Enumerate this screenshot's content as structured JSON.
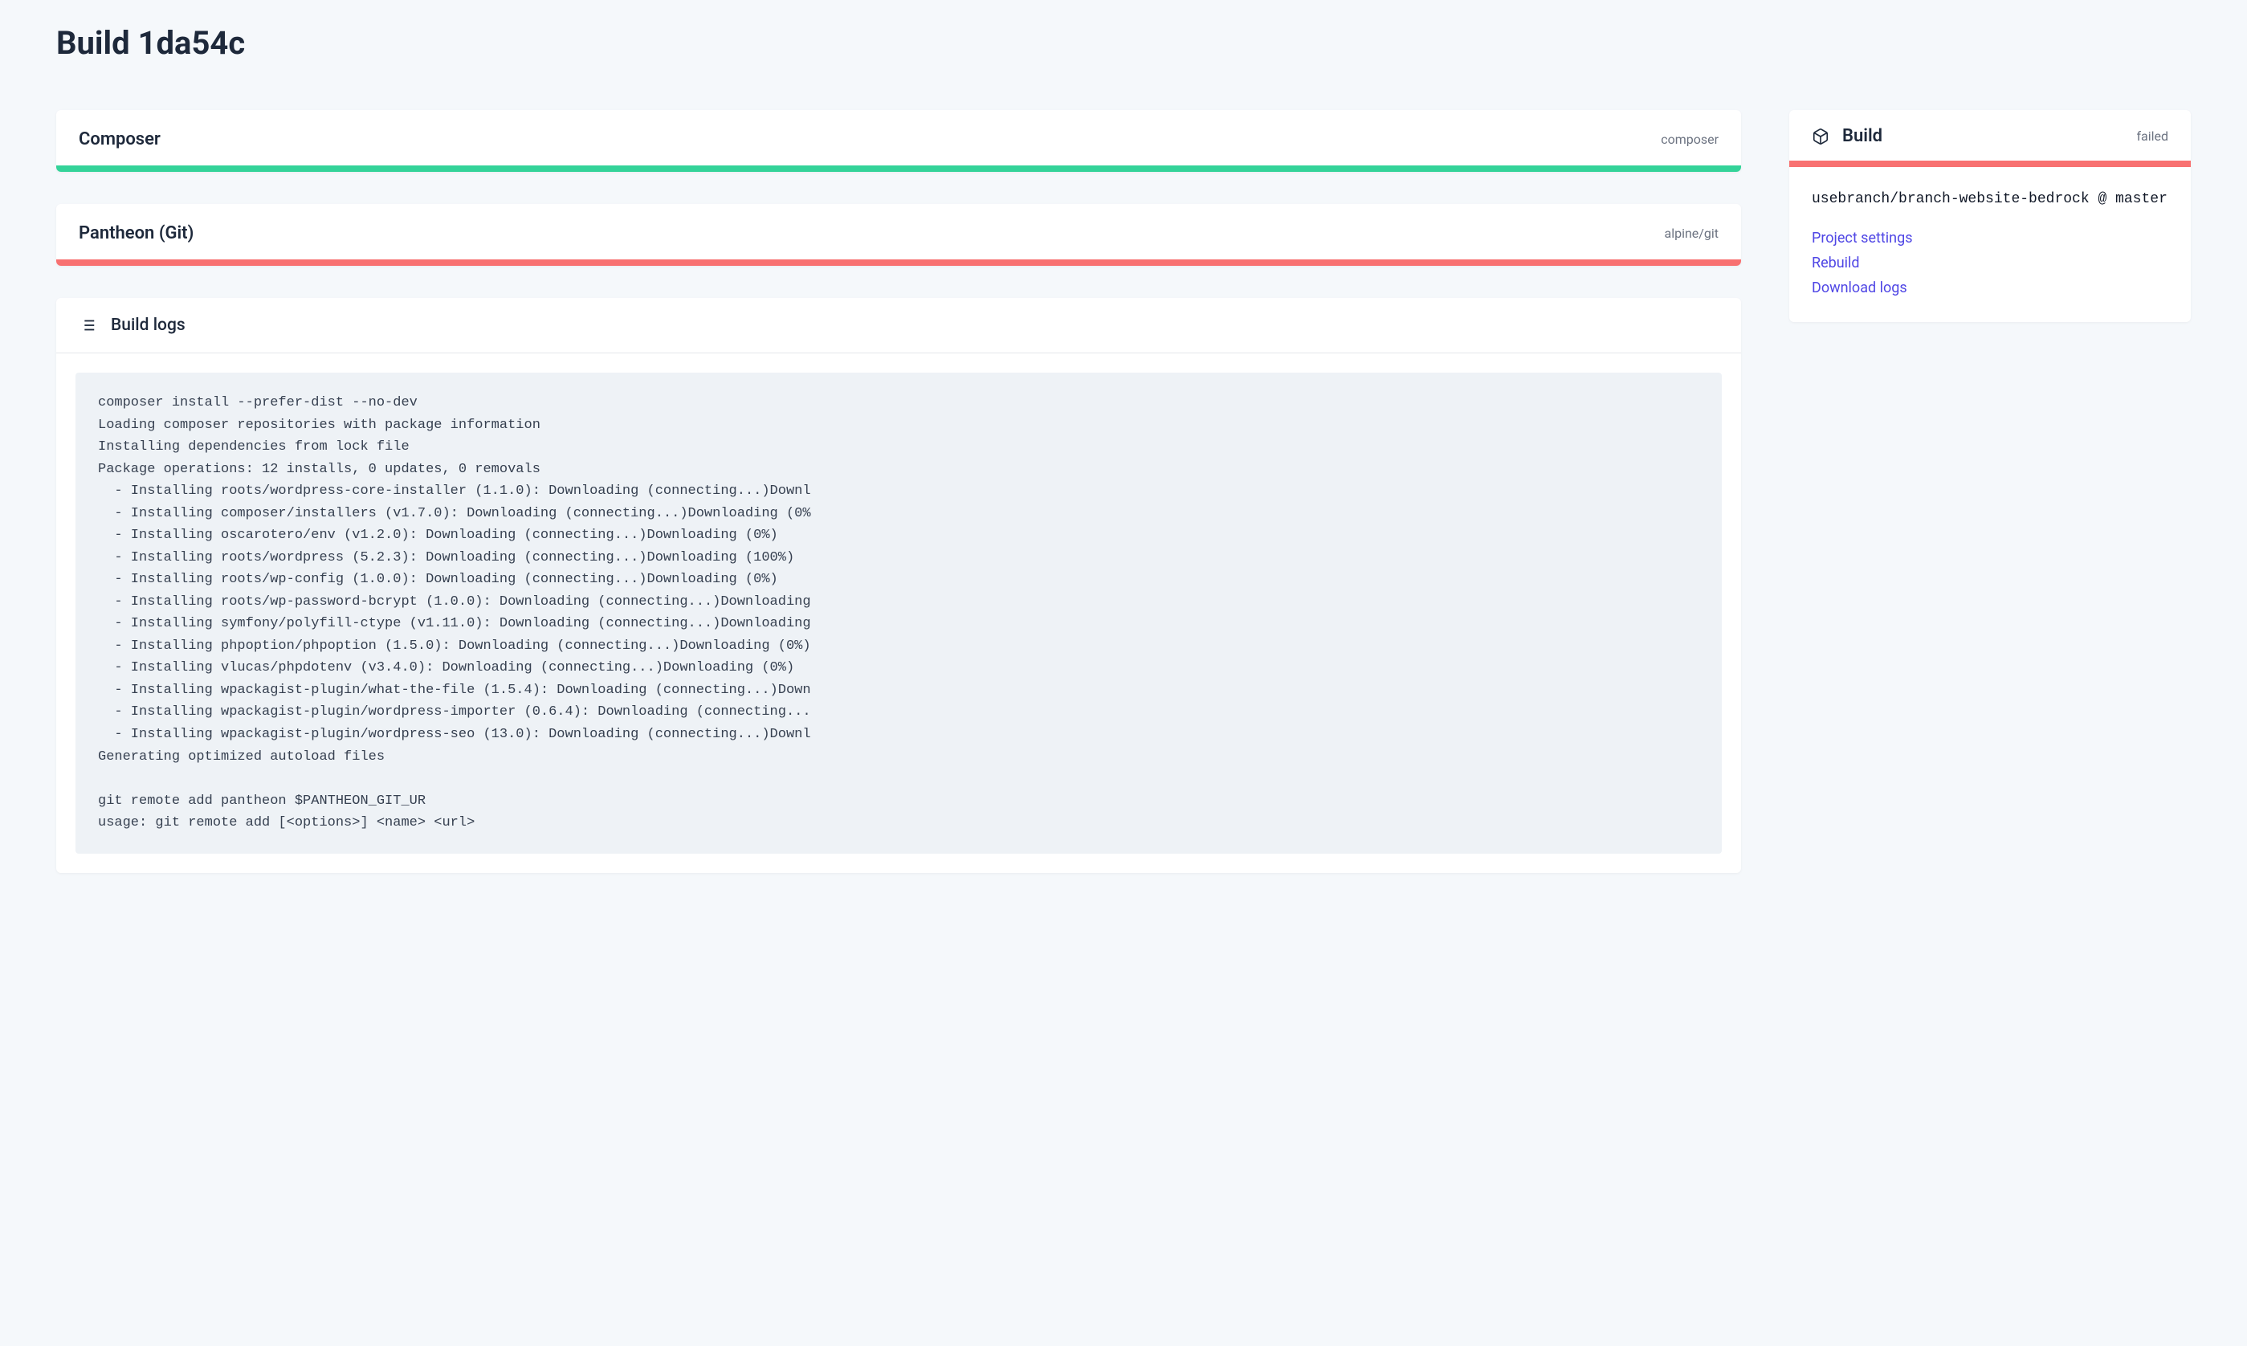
{
  "page": {
    "title": "Build 1da54c"
  },
  "steps": [
    {
      "title": "Composer",
      "image": "composer",
      "status": "success"
    },
    {
      "title": "Pantheon (Git)",
      "image": "alpine/git",
      "status": "failed"
    }
  ],
  "logs": {
    "header": "Build logs",
    "content": "composer install --prefer-dist --no-dev\nLoading composer repositories with package information\nInstalling dependencies from lock file\nPackage operations: 12 installs, 0 updates, 0 removals\n  - Installing roots/wordpress-core-installer (1.1.0): Downloading (connecting...)Downl\n  - Installing composer/installers (v1.7.0): Downloading (connecting...)Downloading (0%\n  - Installing oscarotero/env (v1.2.0): Downloading (connecting...)Downloading (0%)\n  - Installing roots/wordpress (5.2.3): Downloading (connecting...)Downloading (100%)\n  - Installing roots/wp-config (1.0.0): Downloading (connecting...)Downloading (0%)\n  - Installing roots/wp-password-bcrypt (1.0.0): Downloading (connecting...)Downloading\n  - Installing symfony/polyfill-ctype (v1.11.0): Downloading (connecting...)Downloading\n  - Installing phpoption/phpoption (1.5.0): Downloading (connecting...)Downloading (0%)\n  - Installing vlucas/phpdotenv (v3.4.0): Downloading (connecting...)Downloading (0%)\n  - Installing wpackagist-plugin/what-the-file (1.5.4): Downloading (connecting...)Down\n  - Installing wpackagist-plugin/wordpress-importer (0.6.4): Downloading (connecting...\n  - Installing wpackagist-plugin/wordpress-seo (13.0): Downloading (connecting...)Downl\nGenerating optimized autoload files\n\ngit remote add pantheon $PANTHEON_GIT_UR\nusage: git remote add [<options>] <name> <url>"
  },
  "build_panel": {
    "title": "Build",
    "status": "failed",
    "repo": "usebranch/branch-website-bedrock @ master",
    "links": {
      "settings": "Project settings",
      "rebuild": "Rebuild",
      "download": "Download logs"
    }
  }
}
